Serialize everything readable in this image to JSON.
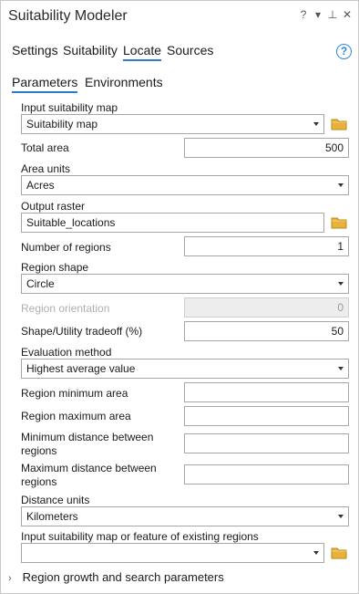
{
  "window": {
    "title": "Suitability Modeler",
    "controls": {
      "help": "?",
      "menu": "▾",
      "pin": "⊥",
      "close": "✕"
    }
  },
  "tabs": [
    {
      "label": "Settings",
      "active": false
    },
    {
      "label": "Suitability",
      "active": false
    },
    {
      "label": "Locate",
      "active": true
    },
    {
      "label": "Sources",
      "active": false
    }
  ],
  "help_label": "?",
  "subtabs": [
    {
      "label": "Parameters",
      "active": true
    },
    {
      "label": "Environments",
      "active": false
    }
  ],
  "fields": {
    "input_map": {
      "label": "Input suitability map",
      "value": "Suitability map"
    },
    "total_area": {
      "label": "Total area",
      "value": "500"
    },
    "area_units": {
      "label": "Area units",
      "value": "Acres"
    },
    "output_raster": {
      "label": "Output raster",
      "value": "Suitable_locations"
    },
    "num_regions": {
      "label": "Number of regions",
      "value": "1"
    },
    "region_shape": {
      "label": "Region shape",
      "value": "Circle"
    },
    "region_orientation": {
      "label": "Region orientation",
      "value": "0",
      "disabled": true
    },
    "tradeoff": {
      "label": "Shape/Utility tradeoff (%)",
      "value": "50"
    },
    "evaluation": {
      "label": "Evaluation method",
      "value": "Highest average value"
    },
    "region_min": {
      "label": "Region minimum area",
      "value": ""
    },
    "region_max": {
      "label": "Region maximum area",
      "value": ""
    },
    "min_dist": {
      "label_line1": "Minimum distance between",
      "label_line2": "regions",
      "value": ""
    },
    "max_dist": {
      "label_line1": "Maximum distance between",
      "label_line2": "regions",
      "value": ""
    },
    "distance_units": {
      "label": "Distance units",
      "value": "Kilometers"
    },
    "existing": {
      "label": "Input suitability map or feature of existing regions",
      "value": ""
    }
  },
  "expander": {
    "label": "Region growth and search parameters",
    "chevron": "›"
  },
  "colors": {
    "accent": "#2c7bd0",
    "help": "#2f86d6",
    "folder": "#e8b23a"
  }
}
